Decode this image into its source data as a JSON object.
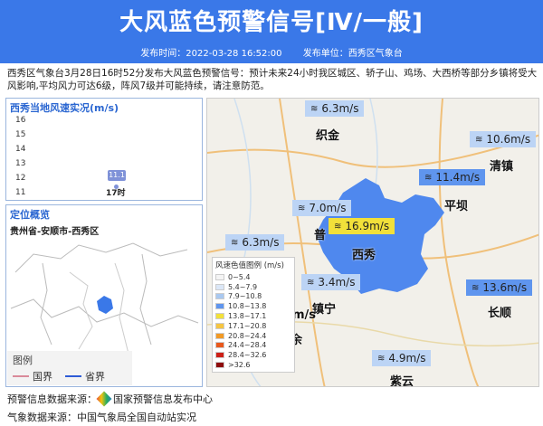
{
  "header": {
    "title": "大风蓝色预警信号[Ⅳ/一般]"
  },
  "meta": {
    "time": "发布时间：2022-03-28 16:52:00",
    "unit": "发布单位：西秀区气象台"
  },
  "description": "西秀区气象台3月28日16时52分发布大风蓝色预警信号：预计未来24小时我区城区、轿子山、鸡场、大西桥等部分乡镇将受大风影响,平均风力可达6级，阵风7级并可能持续，请注意防范。",
  "wind_panel": {
    "title": "西秀当地风速实况(m/s)",
    "y_ticks": [
      "16",
      "15",
      "14",
      "13",
      "12",
      "11"
    ],
    "bar_value": "11.1",
    "bar_time": "17时"
  },
  "chart_data": {
    "type": "scatter",
    "title": "西秀当地风速实况(m/s)",
    "categories": [
      "17时"
    ],
    "values": [
      11.1
    ],
    "ylim": [
      11,
      16
    ]
  },
  "location": {
    "title": "定位概览",
    "region": "贵州省-安顺市-西秀区"
  },
  "legend": {
    "title": "图例",
    "national": "国界",
    "provincial": "省界"
  },
  "map": {
    "badges": [
      {
        "value": "6.3m/s",
        "style": "c1"
      },
      {
        "value": "10.6m/s",
        "style": "c1"
      },
      {
        "value": "11.4m/s",
        "style": "c2"
      },
      {
        "value": "7.0m/s",
        "style": "c1"
      },
      {
        "value": "16.9m/s",
        "style": "c3"
      },
      {
        "value": "6.3m/s",
        "style": "c1"
      },
      {
        "value": "3.4m/s",
        "style": "c1"
      },
      {
        "value": "13.6m/s",
        "style": "c2"
      },
      {
        "value": "4.9m/s",
        "style": "c1"
      }
    ],
    "cities": [
      "织金",
      "清镇",
      "平坝",
      "普",
      "西秀",
      "镇宁",
      "长顺",
      "紫云",
      "m/s",
      "余"
    ],
    "wind_icon": "wind-icon"
  },
  "scale": {
    "title": "风速色值图例 (m/s)",
    "items": [
      {
        "label": "0~5.4",
        "color": "#f4f4f4"
      },
      {
        "label": "5.4~7.9",
        "color": "#dbe7f7"
      },
      {
        "label": "7.9~10.8",
        "color": "#a9c8f0"
      },
      {
        "label": "10.8~13.8",
        "color": "#5f95ee"
      },
      {
        "label": "13.8~17.1",
        "color": "#f2e03a"
      },
      {
        "label": "17.1~20.8",
        "color": "#f5c542"
      },
      {
        "label": "20.8~24.4",
        "color": "#f19a24"
      },
      {
        "label": "24.4~28.4",
        "color": "#e8581c"
      },
      {
        "label": "28.4~32.6",
        "color": "#cc2017"
      },
      {
        "label": ">32.6",
        "color": "#8e0c0c"
      }
    ]
  },
  "footer": {
    "source1_label": "预警信息数据来源：",
    "source1_value": "国家预警信息发布中心",
    "source2": "气象数据来源：中国气象局全国自动站实况"
  }
}
